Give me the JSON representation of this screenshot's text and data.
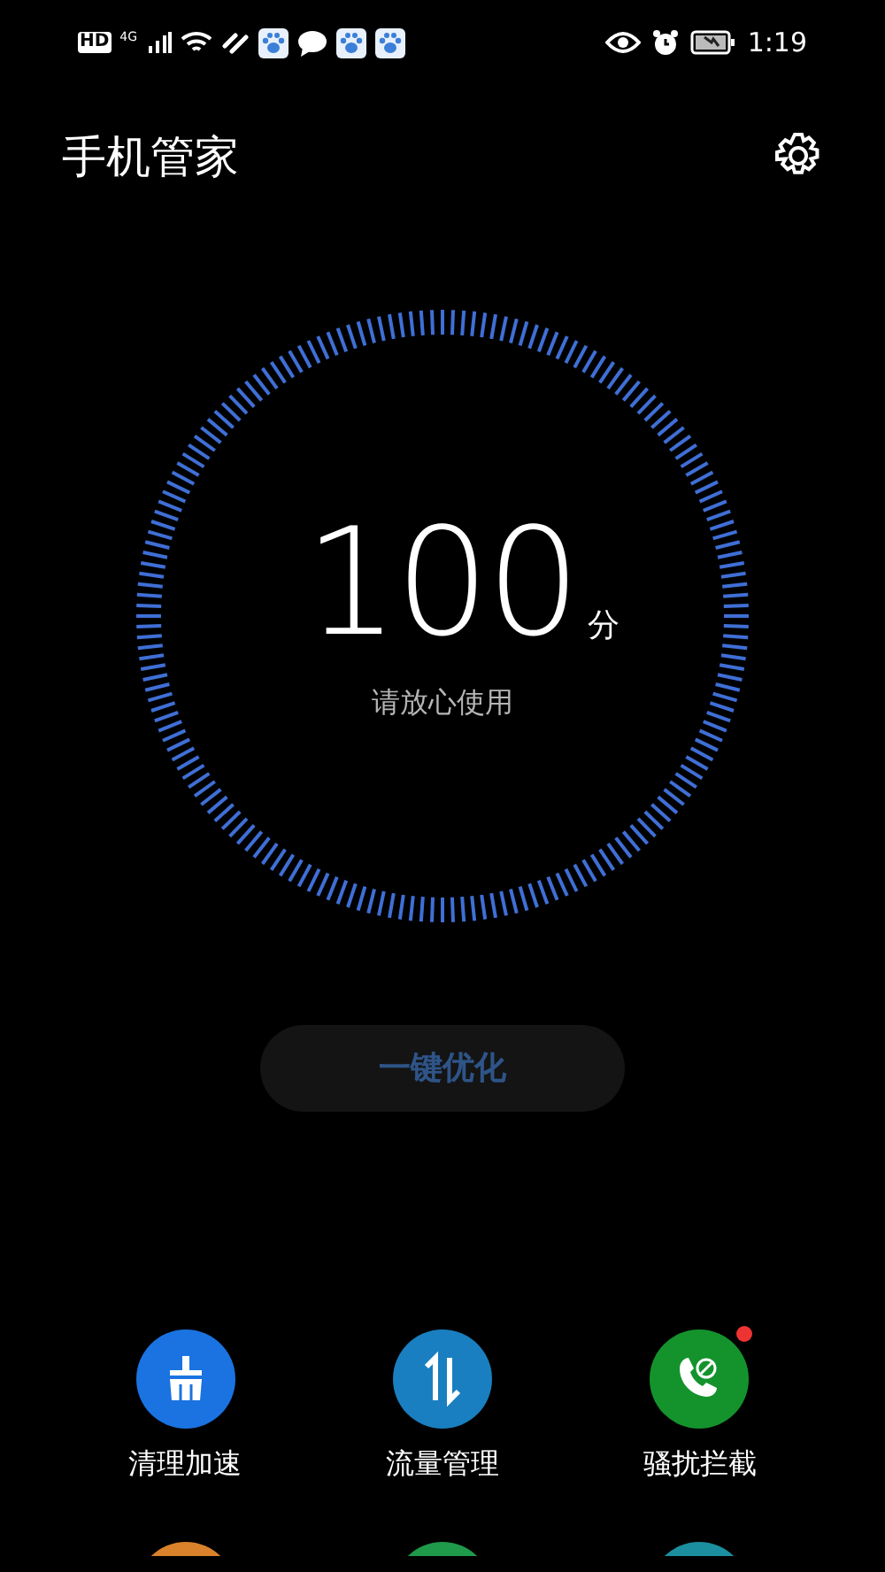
{
  "status_bar": {
    "left_labels": [
      "HD",
      "4G"
    ],
    "time": "1:19"
  },
  "header": {
    "title": "手机管家"
  },
  "score": {
    "value": "100",
    "unit": "分",
    "caption": "请放心使用"
  },
  "optimize_button": {
    "label": "一键优化",
    "disabled": true
  },
  "features": [
    {
      "kind": "broom",
      "label": "清理加速",
      "color": "#1a73e0",
      "badge": false
    },
    {
      "kind": "traffic",
      "label": "流量管理",
      "color": "#1a7fc0",
      "badge": false
    },
    {
      "kind": "call-block",
      "label": "骚扰拦截",
      "color": "#14932d",
      "badge": true
    }
  ],
  "more_features": [
    {
      "color": "#d9822b"
    },
    {
      "color": "#1f9a4a"
    },
    {
      "color": "#1b8fa0"
    }
  ]
}
